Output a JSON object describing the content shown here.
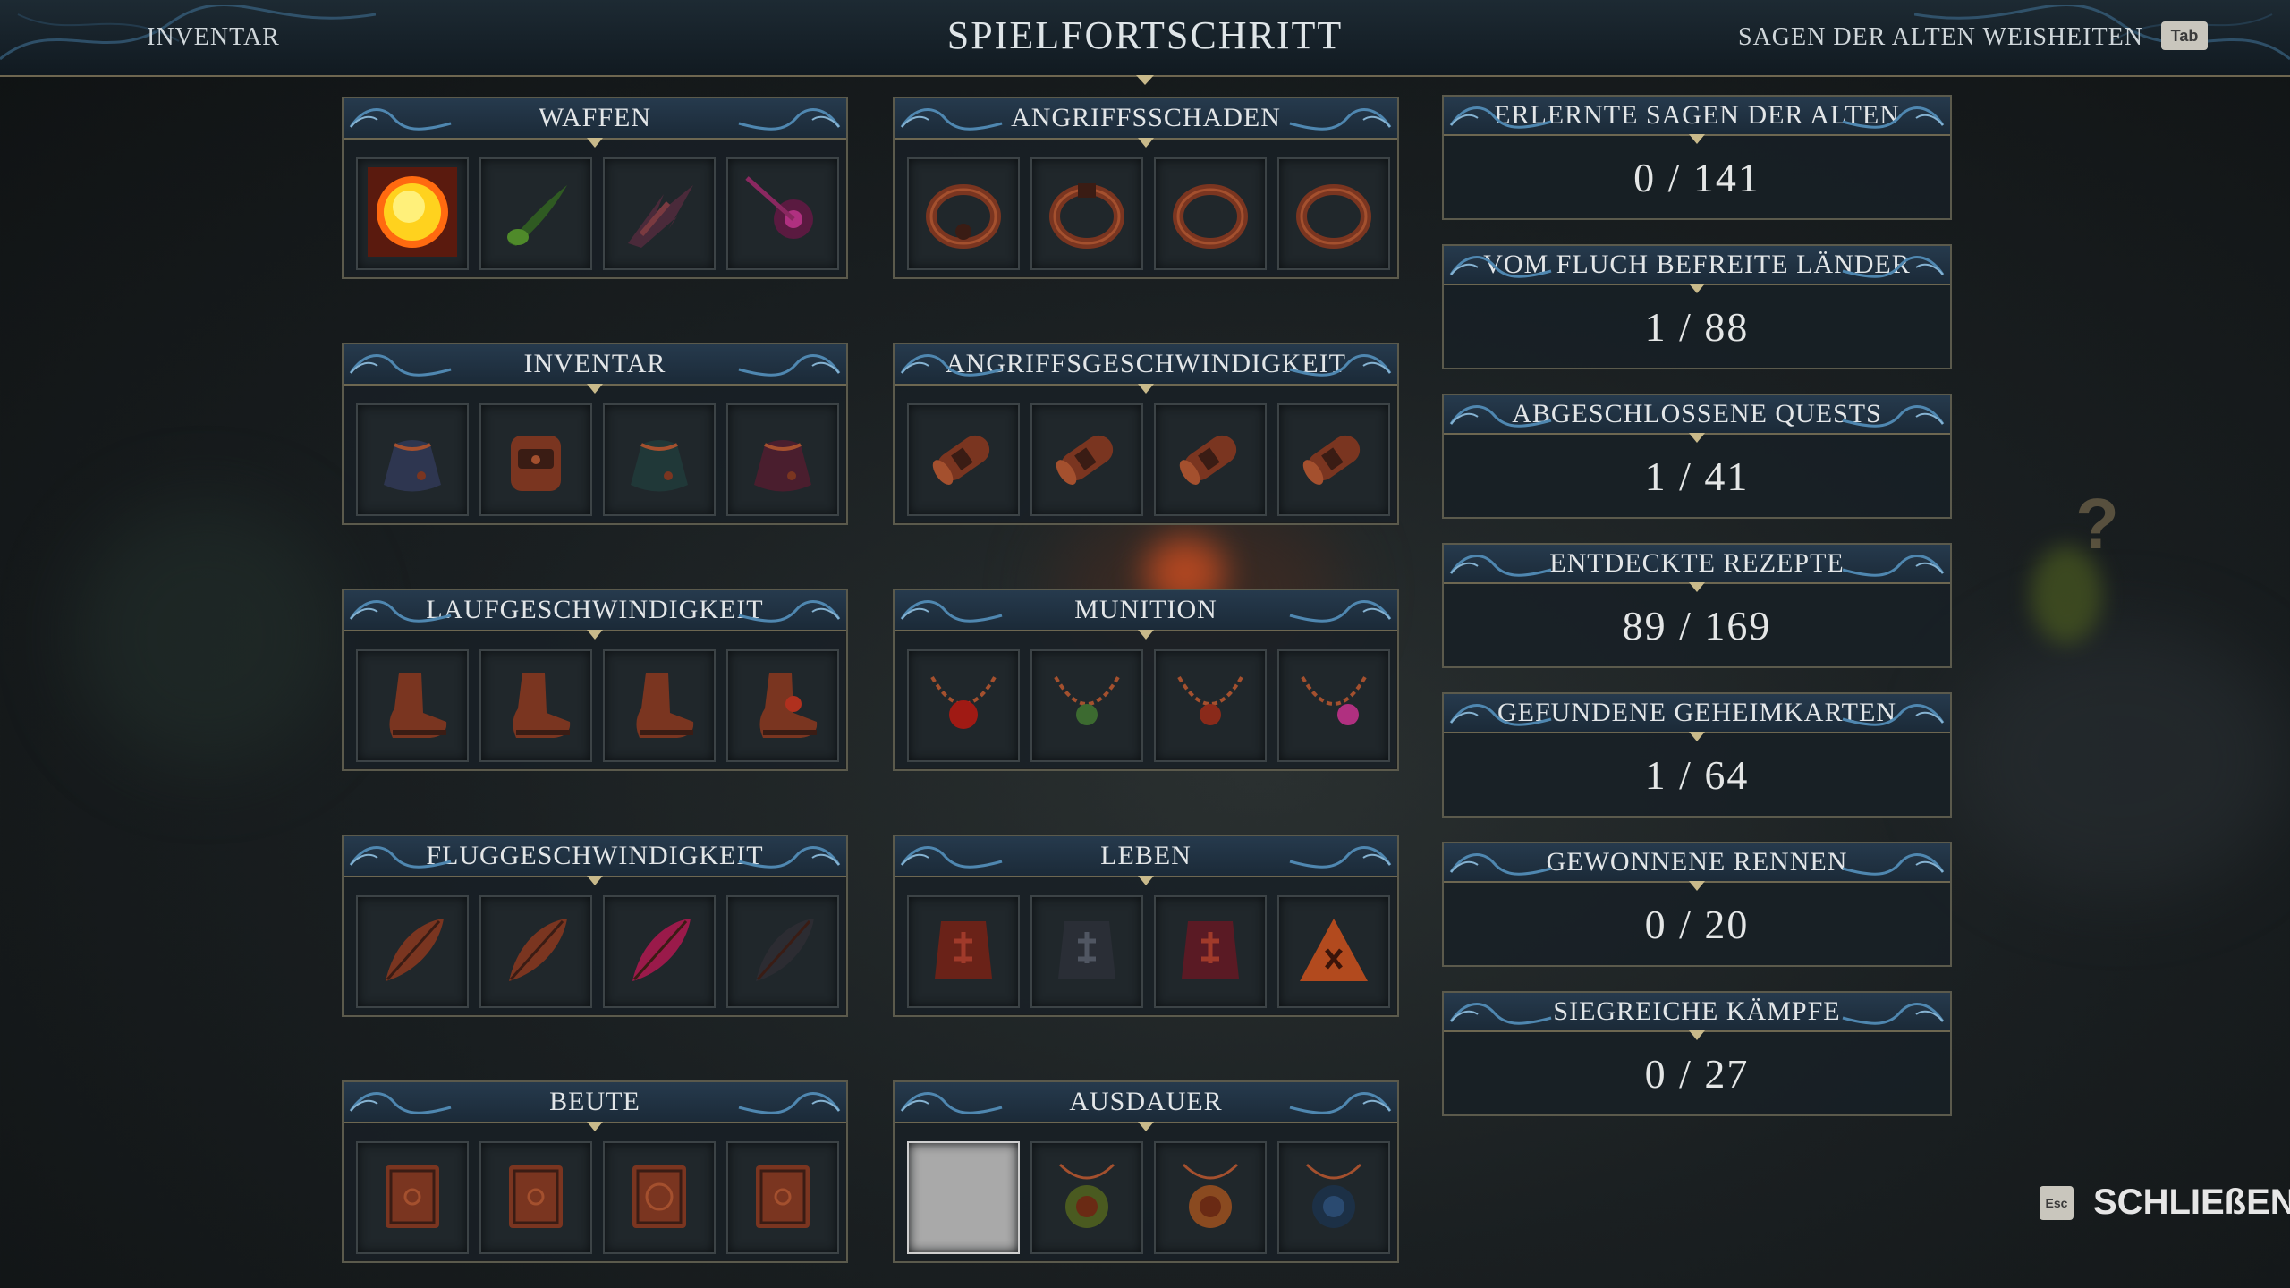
{
  "header": {
    "left_label": "INVENTAR",
    "title": "SPIELFORTSCHRITT",
    "right_label": "SAGEN DER ALTEN WEISHEITEN",
    "right_key": "Tab"
  },
  "categories": [
    {
      "title": "WAFFEN",
      "items": [
        "sun-orb-icon",
        "green-comet-icon",
        "slash-icon",
        "magic-burst-icon"
      ]
    },
    {
      "title": "ANGRIFFSSCHADEN",
      "items": [
        "ring-icon",
        "ring-icon",
        "ring-icon",
        "ring-icon"
      ]
    },
    {
      "title": "INVENTAR",
      "items": [
        "pouch-icon",
        "backpack-icon",
        "pouch-icon",
        "pouch-icon"
      ]
    },
    {
      "title": "ANGRIFFSGESCHWINDIGKEIT",
      "items": [
        "scroll-icon",
        "scroll-icon",
        "scroll-icon",
        "scroll-icon"
      ]
    },
    {
      "title": "LAUFGESCHWINDIGKEIT",
      "items": [
        "boot-icon",
        "boot-icon",
        "boot-icon",
        "boot-icon"
      ]
    },
    {
      "title": "MUNITION",
      "items": [
        "necklace-icon",
        "necklace-icon",
        "necklace-icon",
        "necklace-icon"
      ]
    },
    {
      "title": "FLUGGESCHWINDIGKEIT",
      "items": [
        "feather-icon",
        "feather-icon",
        "feather-icon",
        "feather-icon"
      ]
    },
    {
      "title": "LEBEN",
      "items": [
        "rune-tablet-icon",
        "rune-tablet-icon",
        "rune-tablet-icon",
        "rune-tablet-icon"
      ]
    },
    {
      "title": "BEUTE",
      "items": [
        "book-icon",
        "book-icon",
        "book-icon",
        "book-icon"
      ]
    },
    {
      "title": "AUSDAUER",
      "items": [
        "amulet-icon",
        "amulet-icon",
        "amulet-icon",
        "amulet-icon"
      ]
    }
  ],
  "stats": [
    {
      "label": "ERLERNTE SAGEN DER ALTEN",
      "value": "0 / 141"
    },
    {
      "label": "VOM FLUCH BEFREITE LÄNDER",
      "value": "1 / 88"
    },
    {
      "label": "ABGESCHLOSSENE QUESTS",
      "value": "1 / 41"
    },
    {
      "label": "ENTDECKTE REZEPTE",
      "value": "89 / 169"
    },
    {
      "label": "GEFUNDENE GEHEIMKARTEN",
      "value": "1 / 64"
    },
    {
      "label": "GEWONNENE RENNEN",
      "value": "0 / 20"
    },
    {
      "label": "SIEGREICHE KÄMPFE",
      "value": "0 / 27"
    }
  ],
  "footer": {
    "esc_key": "Esc",
    "close_label": "SCHLIEßEN"
  },
  "world": {
    "question_mark": "?"
  },
  "colors": {
    "accent_blue": "#2c6f9e",
    "gold_border": "#6d6751",
    "panel_bg": "#182026",
    "item_rust": "#8a3b24"
  }
}
